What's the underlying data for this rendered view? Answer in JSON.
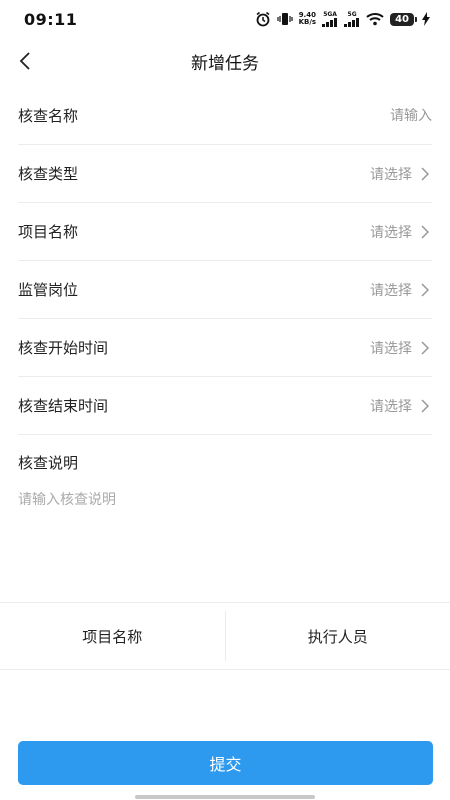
{
  "status_bar": {
    "time": "09:11",
    "net_speed_value": "9.40",
    "net_speed_unit": "KB/s",
    "signal1_label": "5GA",
    "signal2_label": "5G",
    "battery": "40",
    "icons": [
      "alarm-icon",
      "vibrate-icon",
      "signal-icon",
      "wifi-icon",
      "battery-icon",
      "charging-icon"
    ]
  },
  "header": {
    "title": "新增任务",
    "back_icon": "chevron-left-icon"
  },
  "form": {
    "rows": [
      {
        "label": "核查名称",
        "placeholder": "请输入",
        "type": "input"
      },
      {
        "label": "核查类型",
        "placeholder": "请选择",
        "type": "select"
      },
      {
        "label": "项目名称",
        "placeholder": "请选择",
        "type": "select"
      },
      {
        "label": "监管岗位",
        "placeholder": "请选择",
        "type": "select"
      },
      {
        "label": "核查开始时间",
        "placeholder": "请选择",
        "type": "select"
      },
      {
        "label": "核查结束时间",
        "placeholder": "请选择",
        "type": "select"
      }
    ],
    "description": {
      "label": "核查说明",
      "placeholder": "请输入核查说明"
    }
  },
  "tabs": [
    {
      "label": "项目名称"
    },
    {
      "label": "执行人员"
    }
  ],
  "submit": {
    "label": "提交"
  },
  "colors": {
    "accent": "#2d9af0",
    "placeholder": "#999999",
    "divider": "#ececec"
  }
}
